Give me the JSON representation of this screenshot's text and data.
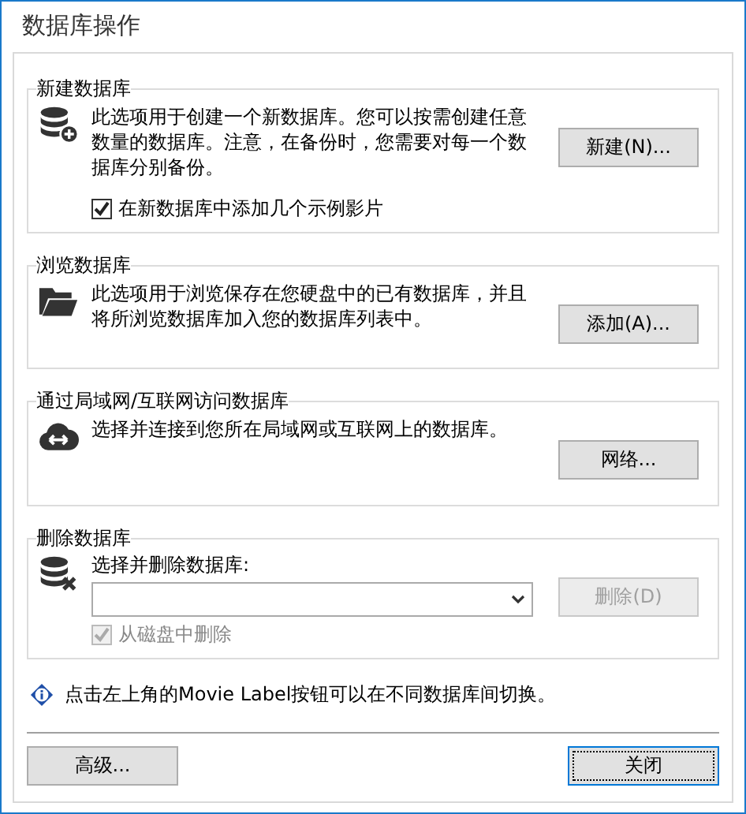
{
  "window": {
    "title": "数据库操作"
  },
  "groups": [
    {
      "title": "新建数据库",
      "kind": "create",
      "description": "此选项用于创建一个新数据库。您可以按需创建任意数量的数据库。注意，在备份时，您需要对每一个数据库分别备份。",
      "checkbox": {
        "label": "在新数据库中添加几个示例影片",
        "checked": true,
        "disabled": false
      },
      "button": {
        "label": "新建(N)...",
        "disabled": false
      }
    },
    {
      "title": "浏览数据库",
      "kind": "browse",
      "description": "此选项用于浏览保存在您硬盘中的已有数据库，并且将所浏览数据库加入您的数据库列表中。",
      "button": {
        "label": "添加(A)...",
        "disabled": false
      }
    },
    {
      "title": "通过局域网/互联网访问数据库",
      "kind": "network",
      "description": "选择并连接到您所在局域网或互联网上的数据库。",
      "button": {
        "label": "网络...",
        "disabled": false
      }
    },
    {
      "title": "删除数据库",
      "kind": "delete",
      "select_label": "选择并删除数据库:",
      "checkbox": {
        "label": "从磁盘中删除",
        "checked": true,
        "disabled": true
      },
      "button": {
        "label": "删除(D)",
        "disabled": true
      }
    }
  ],
  "info": "点击左上角的Movie Label按钮可以在不同数据库间切换。",
  "buttons": [
    {
      "label": "高级...",
      "focused": false
    },
    {
      "label": "关闭",
      "focused": true
    }
  ]
}
